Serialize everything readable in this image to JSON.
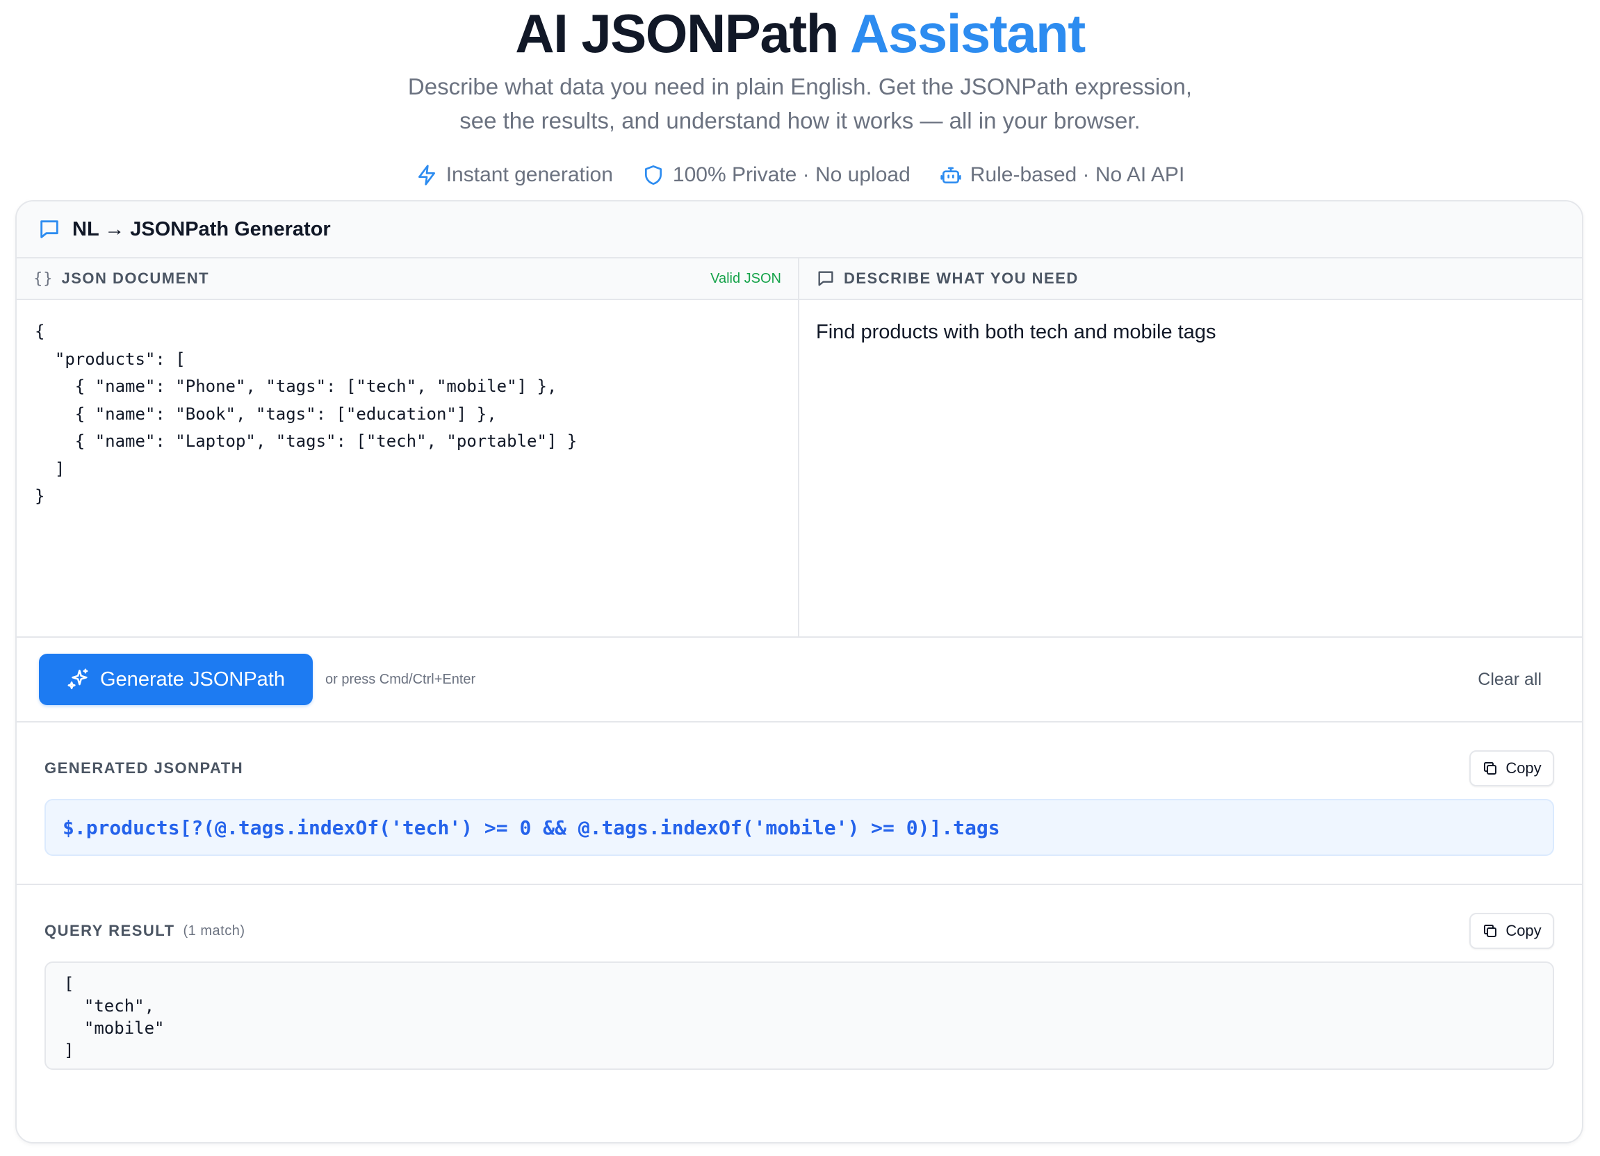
{
  "hero": {
    "title_main": "AI JSONPath ",
    "title_accent": "Assistant",
    "subtitle_line1": "Describe what data you need in plain English. Get the JSONPath expression,",
    "subtitle_line2": "see the results, and understand how it works — all in your browser."
  },
  "features": [
    {
      "icon": "lightning-icon",
      "label": "Instant generation"
    },
    {
      "icon": "shield-icon",
      "label": "100% Private · No upload"
    },
    {
      "icon": "robot-icon",
      "label": "Rule-based · No AI API"
    }
  ],
  "card": {
    "title": "NL → JSONPath Generator"
  },
  "json_pane": {
    "icon": "{}",
    "label": "JSON DOCUMENT",
    "status": "Valid JSON",
    "content": "{\n  \"products\": [\n    { \"name\": \"Phone\", \"tags\": [\"tech\", \"mobile\"] },\n    { \"name\": \"Book\", \"tags\": [\"education\"] },\n    { \"name\": \"Laptop\", \"tags\": [\"tech\", \"portable\"] }\n  ]\n}"
  },
  "prompt_pane": {
    "icon": "chat-bubble-icon",
    "label": "DESCRIBE WHAT YOU NEED",
    "value": "Find products with both tech and mobile tags"
  },
  "actions": {
    "generate_label": "Generate JSONPath",
    "hint": "or press Cmd/Ctrl+Enter",
    "clear_label": "Clear all"
  },
  "generated": {
    "label": "GENERATED JSONPATH",
    "copy_label": "Copy",
    "expression": "$.products[?(@.tags.indexOf('tech') >= 0 && @.tags.indexOf('mobile') >= 0)].tags"
  },
  "result": {
    "label": "QUERY RESULT",
    "match_count": "(1 match)",
    "copy_label": "Copy",
    "content": "[\n  \"tech\",\n  \"mobile\"\n]"
  },
  "colors": {
    "accent": "#2d8cf0",
    "primary_button": "#1d7bf2",
    "valid": "#16a34a",
    "code_text": "#2563eb"
  }
}
